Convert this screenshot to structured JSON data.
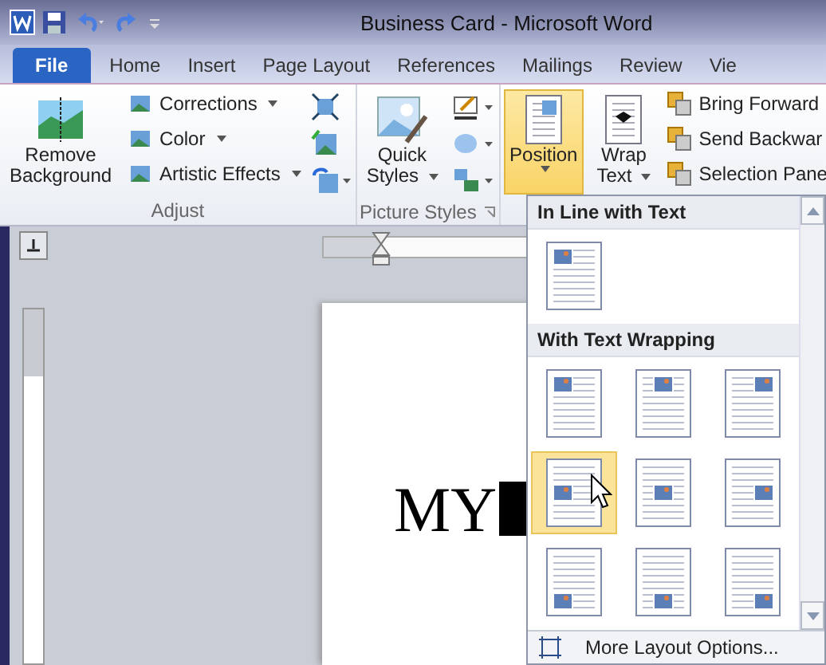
{
  "window": {
    "title": "Business Card  -  Microsoft Word"
  },
  "tabs": [
    {
      "label": "File",
      "kind": "file"
    },
    {
      "label": "Home",
      "kind": "tab"
    },
    {
      "label": "Insert",
      "kind": "tab"
    },
    {
      "label": "Page Layout",
      "kind": "tab"
    },
    {
      "label": "References",
      "kind": "tab"
    },
    {
      "label": "Mailings",
      "kind": "tab"
    },
    {
      "label": "Review",
      "kind": "tab"
    },
    {
      "label": "Vie",
      "kind": "tab"
    }
  ],
  "adjust": {
    "label": "Adjust",
    "large_button": [
      "Remove",
      "Background"
    ],
    "menu_buttons": [
      "Corrections",
      "Color",
      "Artistic Effects"
    ]
  },
  "picture_styles": {
    "label": "Picture Styles",
    "large_button": [
      "Quick",
      "Styles"
    ]
  },
  "arrange": {
    "large_buttons": [
      {
        "label": [
          "Position"
        ],
        "highlighted": true
      },
      {
        "label": [
          "Wrap",
          "Text"
        ],
        "highlighted": false
      }
    ],
    "small_buttons": [
      "Bring Forward",
      "Send Backwar",
      "Selection Pane"
    ]
  },
  "position_menu": {
    "sections": [
      {
        "heading": "In Line with Text",
        "options": [
          {
            "kind": "inline",
            "selected": false
          }
        ]
      },
      {
        "heading": "With Text Wrapping",
        "options": [
          {
            "kind": "top-left",
            "selected": false
          },
          {
            "kind": "top-center",
            "selected": false
          },
          {
            "kind": "top-right",
            "selected": false
          },
          {
            "kind": "middle-left",
            "selected": true
          },
          {
            "kind": "middle-center",
            "selected": false
          },
          {
            "kind": "middle-right",
            "selected": false
          },
          {
            "kind": "bottom-left",
            "selected": false
          },
          {
            "kind": "bottom-center",
            "selected": false
          },
          {
            "kind": "bottom-right",
            "selected": false
          }
        ]
      }
    ],
    "footer": "More Layout Options..."
  },
  "document": {
    "text": "MY"
  }
}
